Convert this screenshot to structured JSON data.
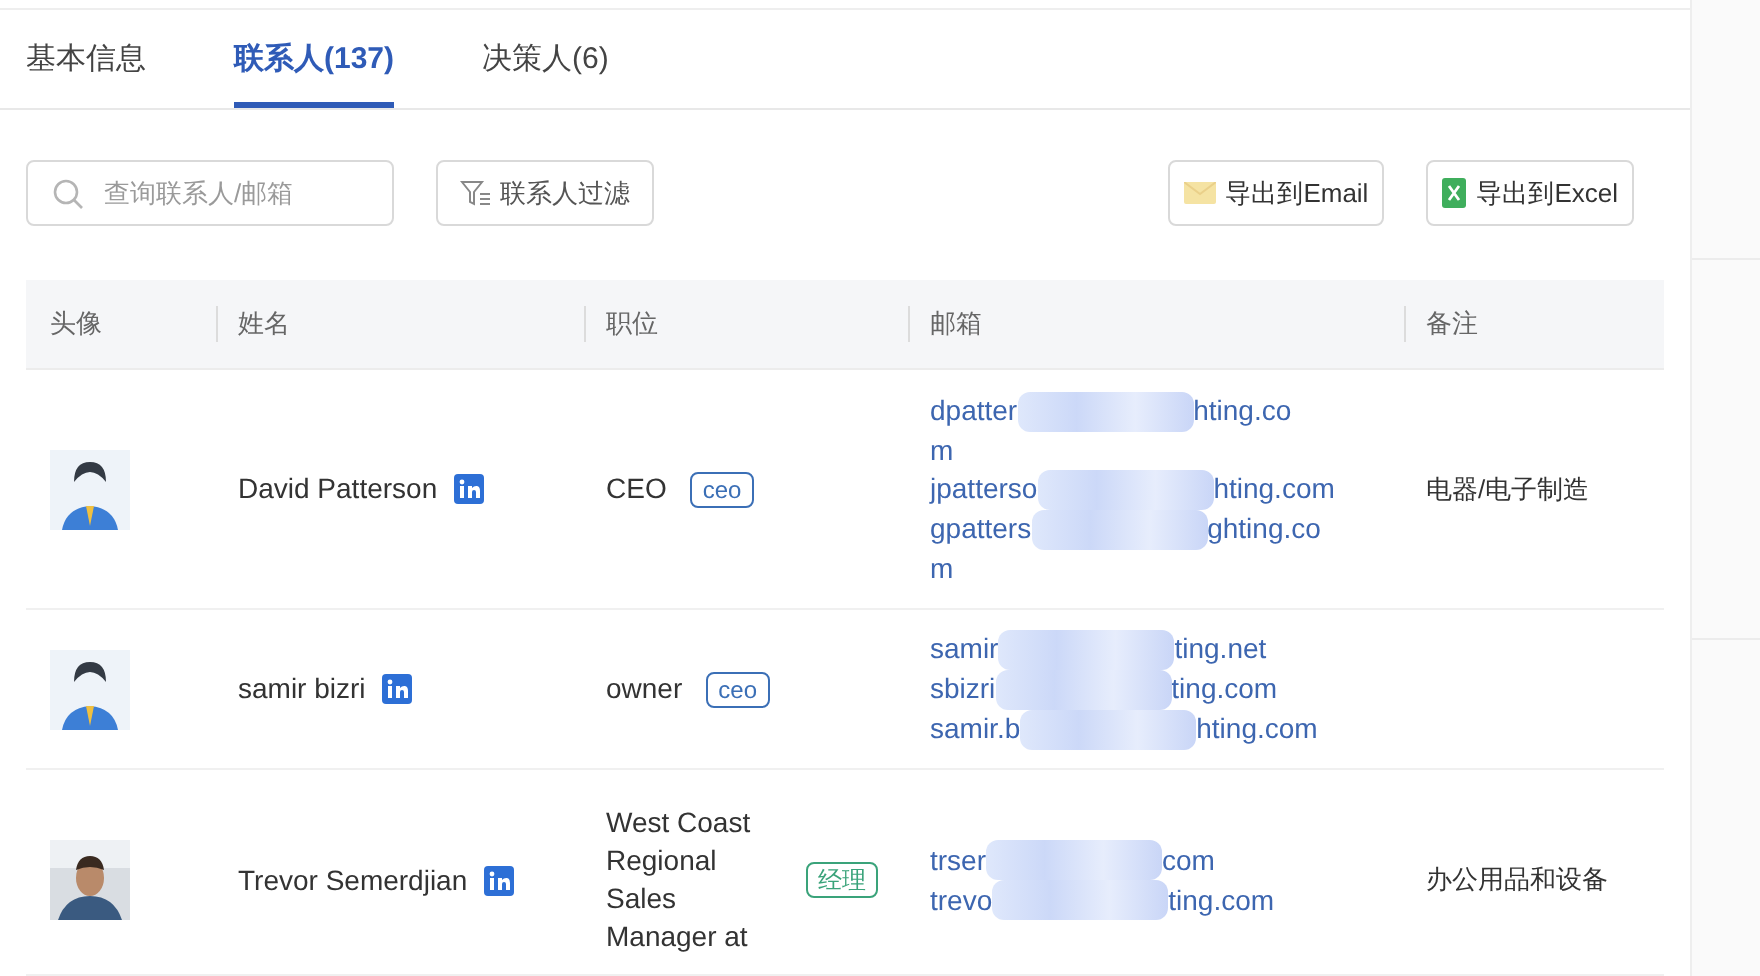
{
  "tabs": [
    {
      "label": "基本信息",
      "selected": false
    },
    {
      "label": "联系人(137)",
      "selected": true
    },
    {
      "label": "决策人(6)",
      "selected": false
    }
  ],
  "search": {
    "placeholder": "查询联系人/邮箱"
  },
  "filter_button": "联系人过滤",
  "export_buttons": [
    {
      "kind": "email",
      "label": "导出到Email"
    },
    {
      "kind": "excel",
      "label": "导出到Excel"
    }
  ],
  "table": {
    "columns": [
      "头像",
      "姓名",
      "职位",
      "邮箱",
      "备注"
    ],
    "rows": [
      {
        "avatar": {
          "kind": "silhouette"
        },
        "name": "David Patterson",
        "title": "CEO",
        "tag": {
          "label": "ceo",
          "color": "#3b6fb6"
        },
        "emails": [
          {
            "start": "dpatter",
            "end": "hting.co",
            "overflow": "m"
          },
          {
            "start": "jpatterso",
            "end": "hting.com"
          },
          {
            "start": "gpatters",
            "end": "ghting.co",
            "overflow": "m"
          }
        ],
        "note": "电器/电子制造"
      },
      {
        "avatar": {
          "kind": "silhouette"
        },
        "name": "samir bizri",
        "title": "owner",
        "tag": {
          "label": "ceo",
          "color": "#3b6fb6"
        },
        "emails": [
          {
            "start": "samir",
            "end": "ting.net"
          },
          {
            "start": "sbizri",
            "end": "ting.com"
          },
          {
            "start": "samir.b",
            "end": "hting.com"
          }
        ]
      },
      {
        "avatar": {
          "kind": "picture"
        },
        "name": "Trevor Semerdjian",
        "title": "West Coast Regional Sales Manager at",
        "tag": {
          "label": "经理",
          "color": "#3aa37a"
        },
        "emails": [
          {
            "start": "trser",
            "end": "com"
          },
          {
            "start": "trevo",
            "end": "ting.com"
          }
        ],
        "note": "办公用品和设备"
      }
    ]
  }
}
